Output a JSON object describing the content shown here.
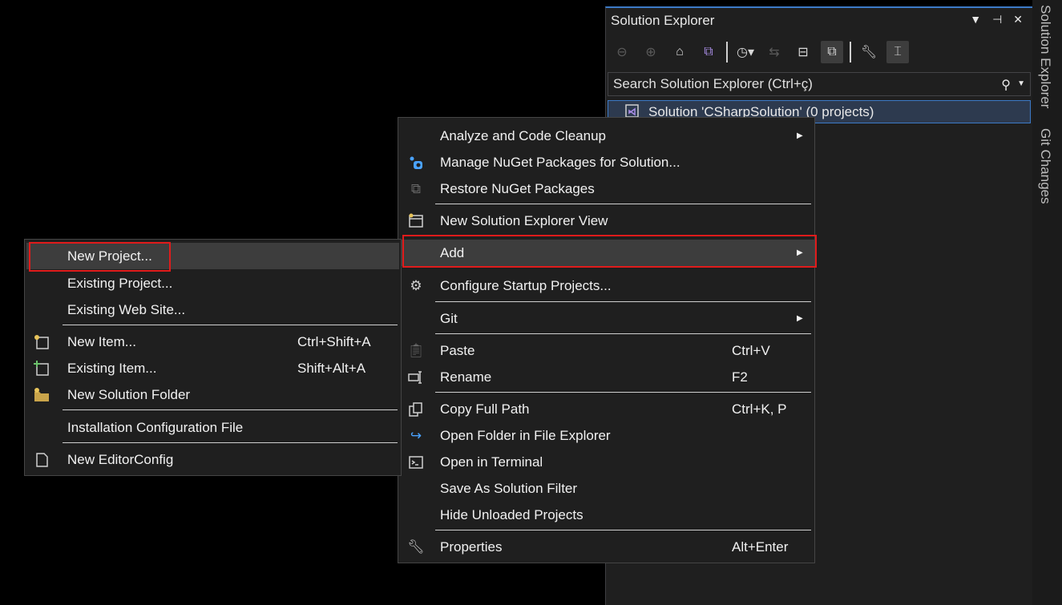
{
  "solution_explorer": {
    "title": "Solution Explorer",
    "title_icons": [
      "dropdown-icon",
      "pin-icon",
      "close-icon"
    ],
    "search_placeholder": "Search Solution Explorer (Ctrl+ç)",
    "tree_item": "Solution 'CSharpSolution' (0 projects)"
  },
  "side_tabs": {
    "tab1": "Solution Explorer",
    "tab2": "Git Changes"
  },
  "context_menu": {
    "analyze": "Analyze and Code Cleanup",
    "nuget_manage": "Manage NuGet Packages for Solution...",
    "nuget_restore": "Restore NuGet Packages",
    "new_view": "New Solution Explorer View",
    "add": "Add",
    "configure": "Configure Startup Projects...",
    "git": "Git",
    "paste": "Paste",
    "paste_sc": "Ctrl+V",
    "rename": "Rename",
    "rename_sc": "F2",
    "copy_path": "Copy Full Path",
    "copy_path_sc": "Ctrl+K, P",
    "open_folder": "Open Folder in File Explorer",
    "open_terminal": "Open in Terminal",
    "save_filter": "Save As Solution Filter",
    "hide_unloaded": "Hide Unloaded Projects",
    "properties": "Properties",
    "properties_sc": "Alt+Enter"
  },
  "add_submenu": {
    "new_project": "New Project...",
    "existing_project": "Existing Project...",
    "existing_web": "Existing Web Site...",
    "new_item": "New Item...",
    "new_item_sc": "Ctrl+Shift+A",
    "existing_item": "Existing Item...",
    "existing_item_sc": "Shift+Alt+A",
    "new_folder": "New Solution Folder",
    "install_config": "Installation Configuration File",
    "editorconfig": "New EditorConfig"
  },
  "colors": {
    "highlight_border": "#e01b1b",
    "accent": "#3c7ac7",
    "menu_bg": "#1f1f1f"
  }
}
